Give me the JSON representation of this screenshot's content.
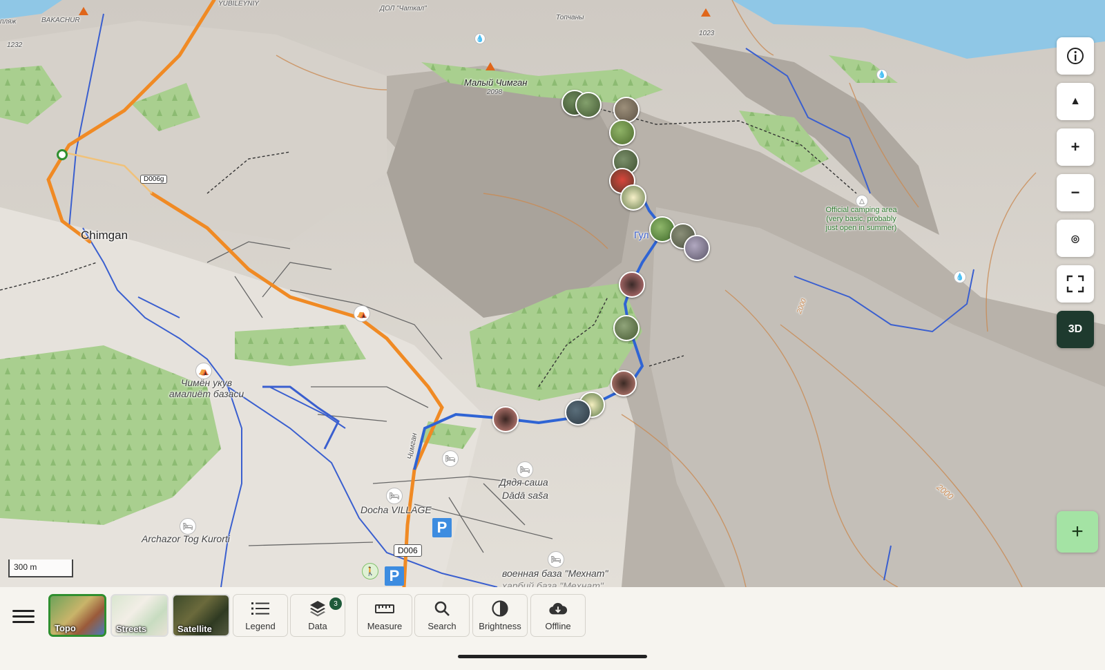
{
  "map": {
    "labels": {
      "town_chimgan": "Chimgan",
      "yubileyniy": "YUBILEYNIY",
      "bakachur": "BAKACHUR",
      "dol_chatkal": "ДОЛ \"Чаткал\"",
      "topchany": "Топчаны",
      "elev_1232": "1232",
      "elev_1023": "1023",
      "peak_name": "Малый Чимган",
      "peak_elev": "2098",
      "camping": "Official camping area (very basic, probably just open in summer)",
      "gul": "Гул",
      "chimen_base": "Чимён укув амалиёт базаси",
      "dyadya_sasha": "Дядя саша",
      "dada_sasa": "Dādā saša",
      "docha_village": "Docha VILLAGE",
      "archazor": "Archazor Tog Kurorti",
      "voennaya_baza": "военная база \"Мехнат\"",
      "voennaya_baza2": "ҳарбий база \"Меҳнат\"",
      "chimgan_road": "Чимган",
      "contour_2000": "2000",
      "contour_2000b": "2000",
      "beach": "пляж"
    },
    "road_shields": {
      "d006g": "D006g",
      "d006": "D006"
    },
    "scale_bar": "300 m",
    "parking_label": "P",
    "controls": {
      "info": "i",
      "compass": "▲",
      "zoom_in": "+",
      "zoom_out": "−",
      "locate": "◎",
      "fullscreen": "⛶",
      "three_d": "3D",
      "add": "+"
    }
  },
  "bottom_bar": {
    "layers": [
      {
        "label": "Topo",
        "active": true
      },
      {
        "label": "Streets",
        "active": false
      },
      {
        "label": "Satellite",
        "active": false
      }
    ],
    "tools": [
      {
        "label": "Legend",
        "icon": "list-icon"
      },
      {
        "label": "Data",
        "icon": "layers-icon",
        "badge": "3"
      },
      {
        "label": "Measure",
        "icon": "ruler-icon"
      },
      {
        "label": "Search",
        "icon": "search-icon"
      },
      {
        "label": "Brightness",
        "icon": "brightness-icon"
      },
      {
        "label": "Offline",
        "icon": "cloud-download-icon"
      }
    ]
  },
  "colors": {
    "trail_blue": "#2f64d4",
    "main_road": "#f08a24",
    "forest": "#a9cf8f",
    "accent_green": "#1e3a2e",
    "add_button": "#a4e3a4"
  }
}
